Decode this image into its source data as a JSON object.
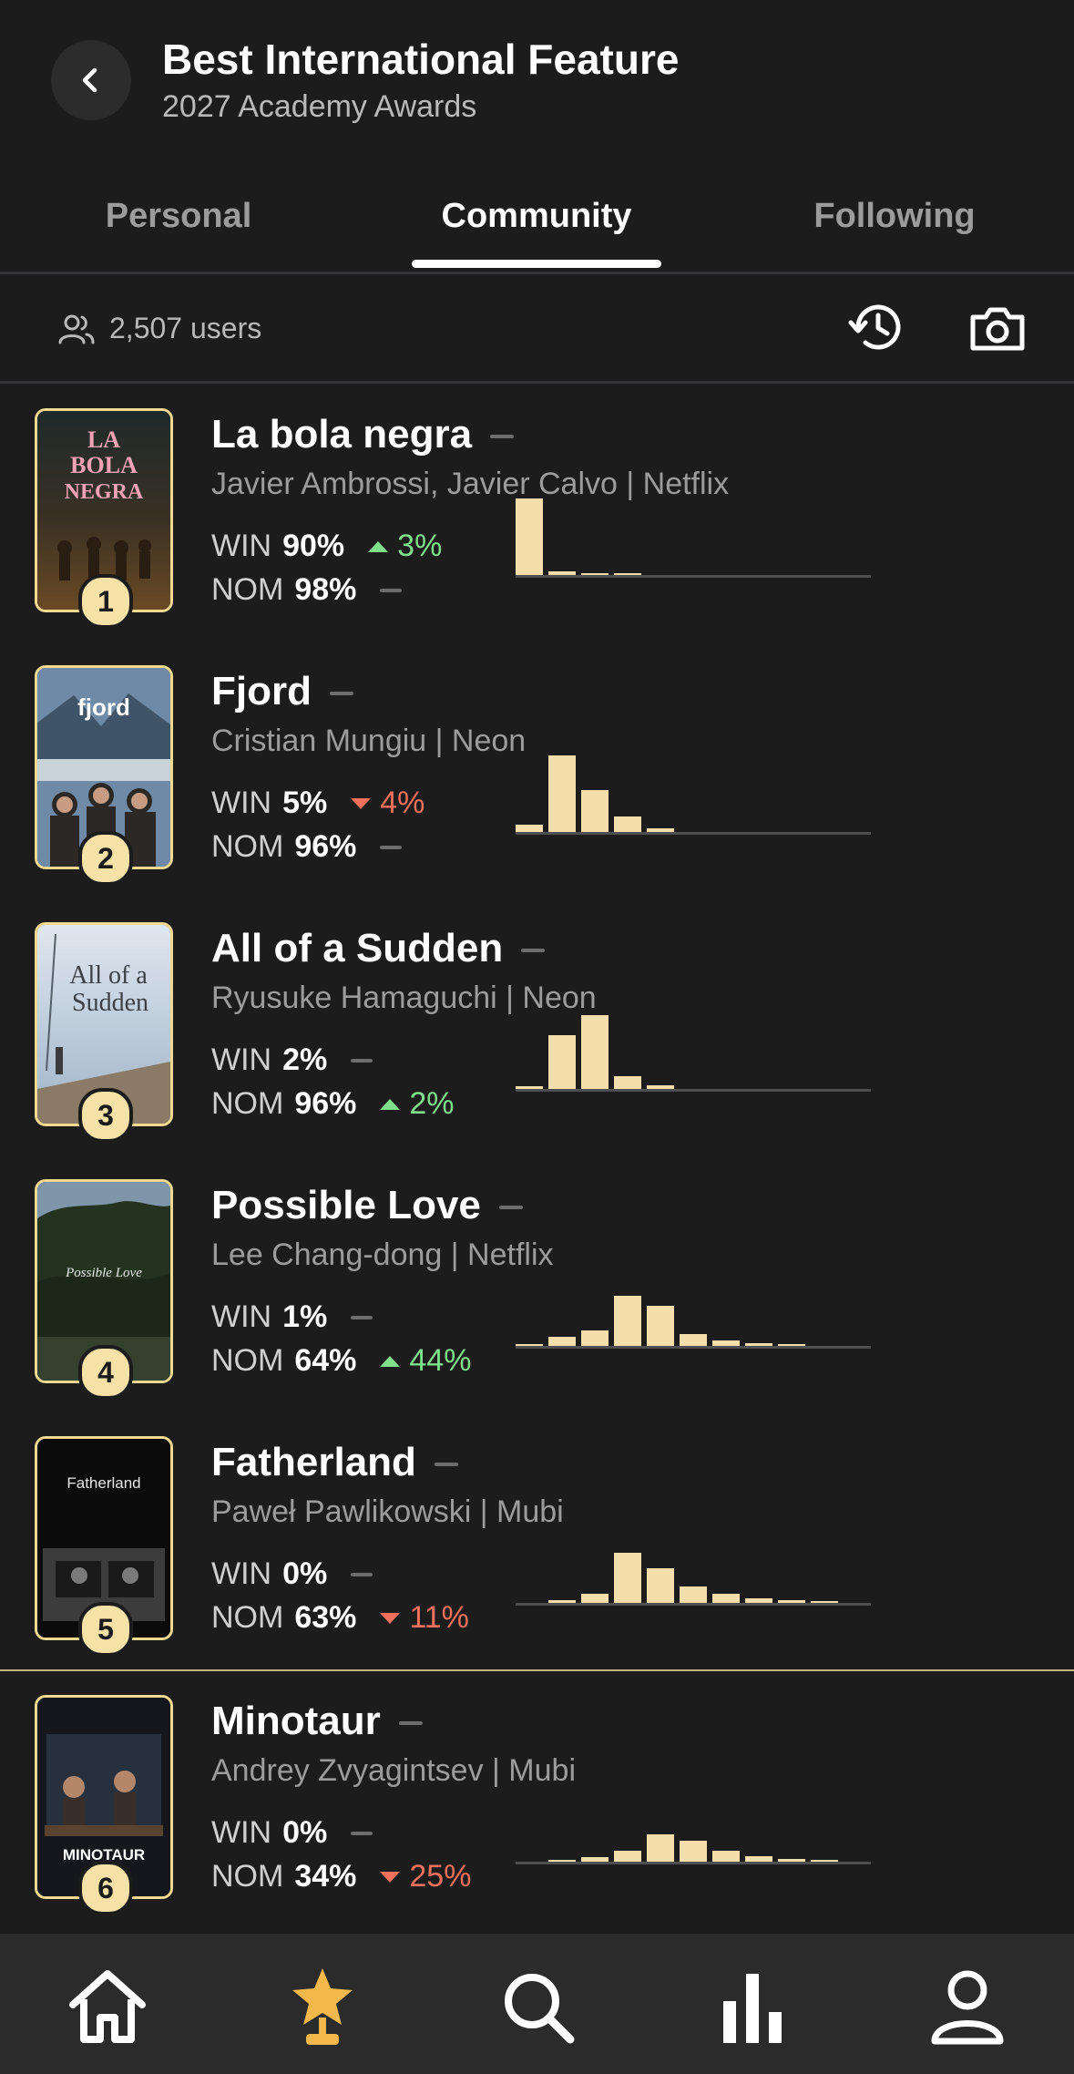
{
  "header": {
    "title": "Best International Feature",
    "subtitle": "2027 Academy Awards",
    "back_icon": "chevron-left-icon"
  },
  "tabs": [
    {
      "label": "Personal",
      "active": false
    },
    {
      "label": "Community",
      "active": true
    },
    {
      "label": "Following",
      "active": false
    }
  ],
  "stats": {
    "users_label": "2,507 users",
    "users_icon": "users-icon",
    "history_icon": "history-icon",
    "camera_icon": "camera-icon"
  },
  "films": [
    {
      "rank": "1",
      "title": "La bola negra",
      "credits": "Javier Ambrossi, Javier Calvo | Netflix",
      "win_label": "WIN",
      "win": "90%",
      "win_change": "3%",
      "win_dir": "up",
      "nom_label": "NOM",
      "nom": "98%",
      "nom_change": "",
      "nom_dir": "flat",
      "poster_text": "LA BOLA NEGRA",
      "distribution": [
        1.0,
        0.05,
        0.02,
        0.02,
        0,
        0,
        0,
        0,
        0,
        0
      ]
    },
    {
      "rank": "2",
      "title": "Fjord",
      "credits": "Cristian Mungiu | Neon",
      "win_label": "WIN",
      "win": "5%",
      "win_change": "4%",
      "win_dir": "down",
      "nom_label": "NOM",
      "nom": "96%",
      "nom_change": "",
      "nom_dir": "flat",
      "poster_text": "fjord",
      "distribution": [
        0.1,
        1.0,
        0.55,
        0.2,
        0.05,
        0,
        0,
        0,
        0,
        0
      ]
    },
    {
      "rank": "3",
      "title": "All of a Sudden",
      "credits": "Ryusuke Hamaguchi | Neon",
      "win_label": "WIN",
      "win": "2%",
      "win_change": "",
      "win_dir": "flat",
      "nom_label": "NOM",
      "nom": "96%",
      "nom_change": "2%",
      "nom_dir": "up",
      "poster_text": "All of a Sudden",
      "distribution": [
        0.04,
        0.7,
        0.97,
        0.17,
        0.05,
        0,
        0,
        0,
        0,
        0
      ]
    },
    {
      "rank": "4",
      "title": "Possible Love",
      "credits": "Lee Chang-dong | Netflix",
      "win_label": "WIN",
      "win": "1%",
      "win_change": "",
      "win_dir": "flat",
      "nom_label": "NOM",
      "nom": "64%",
      "nom_change": "44%",
      "nom_dir": "up",
      "poster_text": "Possible Love",
      "distribution": [
        0.02,
        0.12,
        0.2,
        0.66,
        0.52,
        0.16,
        0.07,
        0.04,
        0.02,
        0
      ]
    },
    {
      "rank": "5",
      "title": "Fatherland",
      "credits": "Paweł Pawlikowski | Mubi",
      "win_label": "WIN",
      "win": "0%",
      "win_change": "",
      "win_dir": "flat",
      "nom_label": "NOM",
      "nom": "63%",
      "nom_change": "11%",
      "nom_dir": "down",
      "poster_text": "Fatherland",
      "distribution": [
        0,
        0.04,
        0.12,
        0.66,
        0.45,
        0.22,
        0.12,
        0.06,
        0.03,
        0.02
      ]
    },
    {
      "rank": "6",
      "title": "Minotaur",
      "credits": "Andrey Zvyagintsev | Mubi",
      "win_label": "WIN",
      "win": "0%",
      "win_change": "",
      "win_dir": "flat",
      "nom_label": "NOM",
      "nom": "34%",
      "nom_change": "25%",
      "nom_dir": "down",
      "poster_text": "MINOTAUR",
      "distribution": [
        0,
        0.02,
        0.06,
        0.14,
        0.36,
        0.27,
        0.14,
        0.07,
        0.03,
        0.02
      ]
    }
  ],
  "nav": [
    {
      "icon": "home-icon",
      "active": false
    },
    {
      "icon": "award-star-icon",
      "active": true
    },
    {
      "icon": "search-icon",
      "active": false
    },
    {
      "icon": "bar-chart-icon",
      "active": false
    },
    {
      "icon": "profile-icon",
      "active": false
    }
  ],
  "colors": {
    "background": "#1c1c1d",
    "accent_gold": "#f5deab",
    "up_green": "#7fe08b",
    "down_red": "#f0705b",
    "nav_active": "#f2b84b"
  }
}
